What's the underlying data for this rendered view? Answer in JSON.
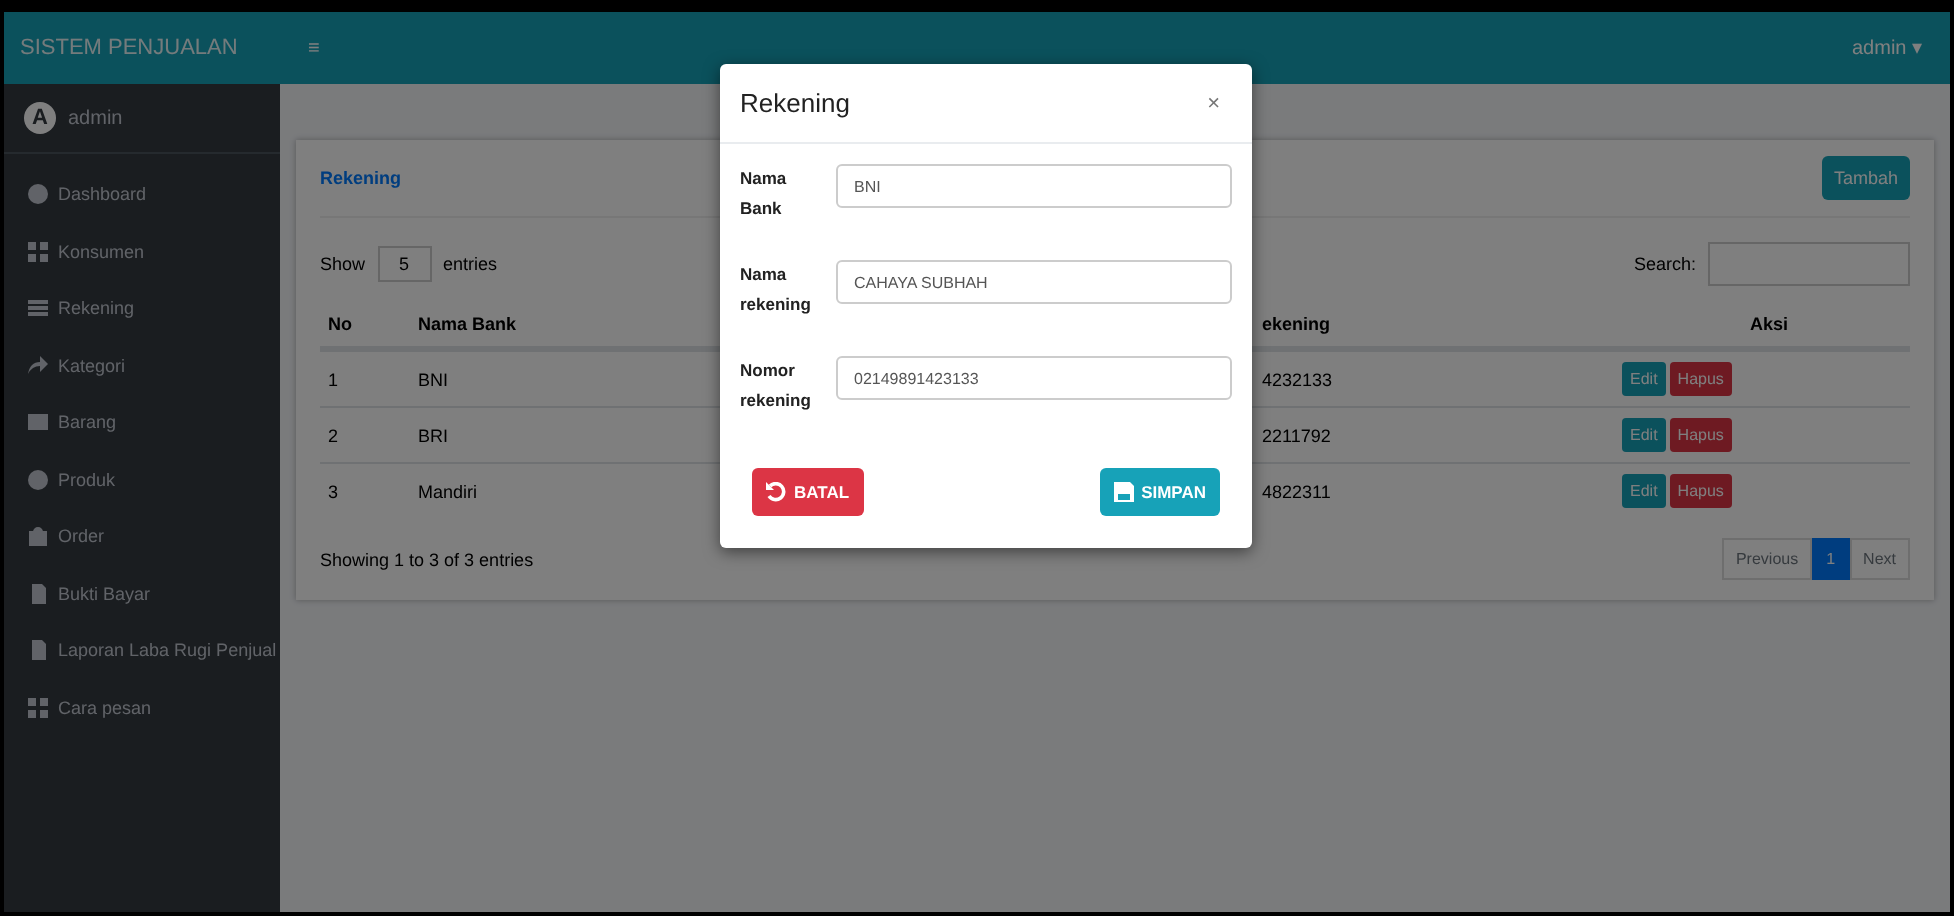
{
  "brand": "SISTEM PENJUALAN",
  "topbar": {
    "menu_glyph": "≡",
    "user": "admin ▾"
  },
  "sidebar": {
    "user": {
      "initial": "A",
      "name": "admin"
    },
    "items": [
      {
        "label": "Dashboard"
      },
      {
        "label": "Konsumen"
      },
      {
        "label": "Rekening"
      },
      {
        "label": "Kategori"
      },
      {
        "label": "Barang"
      },
      {
        "label": "Produk"
      },
      {
        "label": "Order"
      },
      {
        "label": "Bukti Bayar"
      },
      {
        "label": "Laporan Laba Rugi Penjual"
      },
      {
        "label": "Cara pesan"
      }
    ]
  },
  "card": {
    "title": "Rekening",
    "add_button": "Tambah",
    "show_label": "Show",
    "show_value": "5",
    "entries_label": "entries",
    "search_label": "Search:",
    "table": {
      "columns": [
        "No",
        "Nama Bank",
        "ekening",
        "Aksi"
      ],
      "rows": [
        {
          "no": "1",
          "bank": "BNI",
          "number": "4232133",
          "edit": "Edit",
          "delete": "Hapus"
        },
        {
          "no": "2",
          "bank": "BRI",
          "number": "2211792",
          "edit": "Edit",
          "delete": "Hapus"
        },
        {
          "no": "3",
          "bank": "Mandiri",
          "number": "4822311",
          "edit": "Edit",
          "delete": "Hapus"
        }
      ]
    },
    "info": "Showing 1 to 3 of 3 entries",
    "pagination": {
      "previous": "Previous",
      "pages": [
        {
          "label": "1",
          "selected": true
        }
      ],
      "next": "Next"
    }
  },
  "modal": {
    "title": "Rekening",
    "close": "×",
    "fields": [
      {
        "label": "Nama Bank",
        "value": "BNI"
      },
      {
        "label": "Nama rekening",
        "value": "CAHAYA SUBHAH"
      },
      {
        "label": "Nomor rekening",
        "value": "02149891423133"
      }
    ],
    "cancel": "BATAL",
    "save": "SIMPAN"
  }
}
